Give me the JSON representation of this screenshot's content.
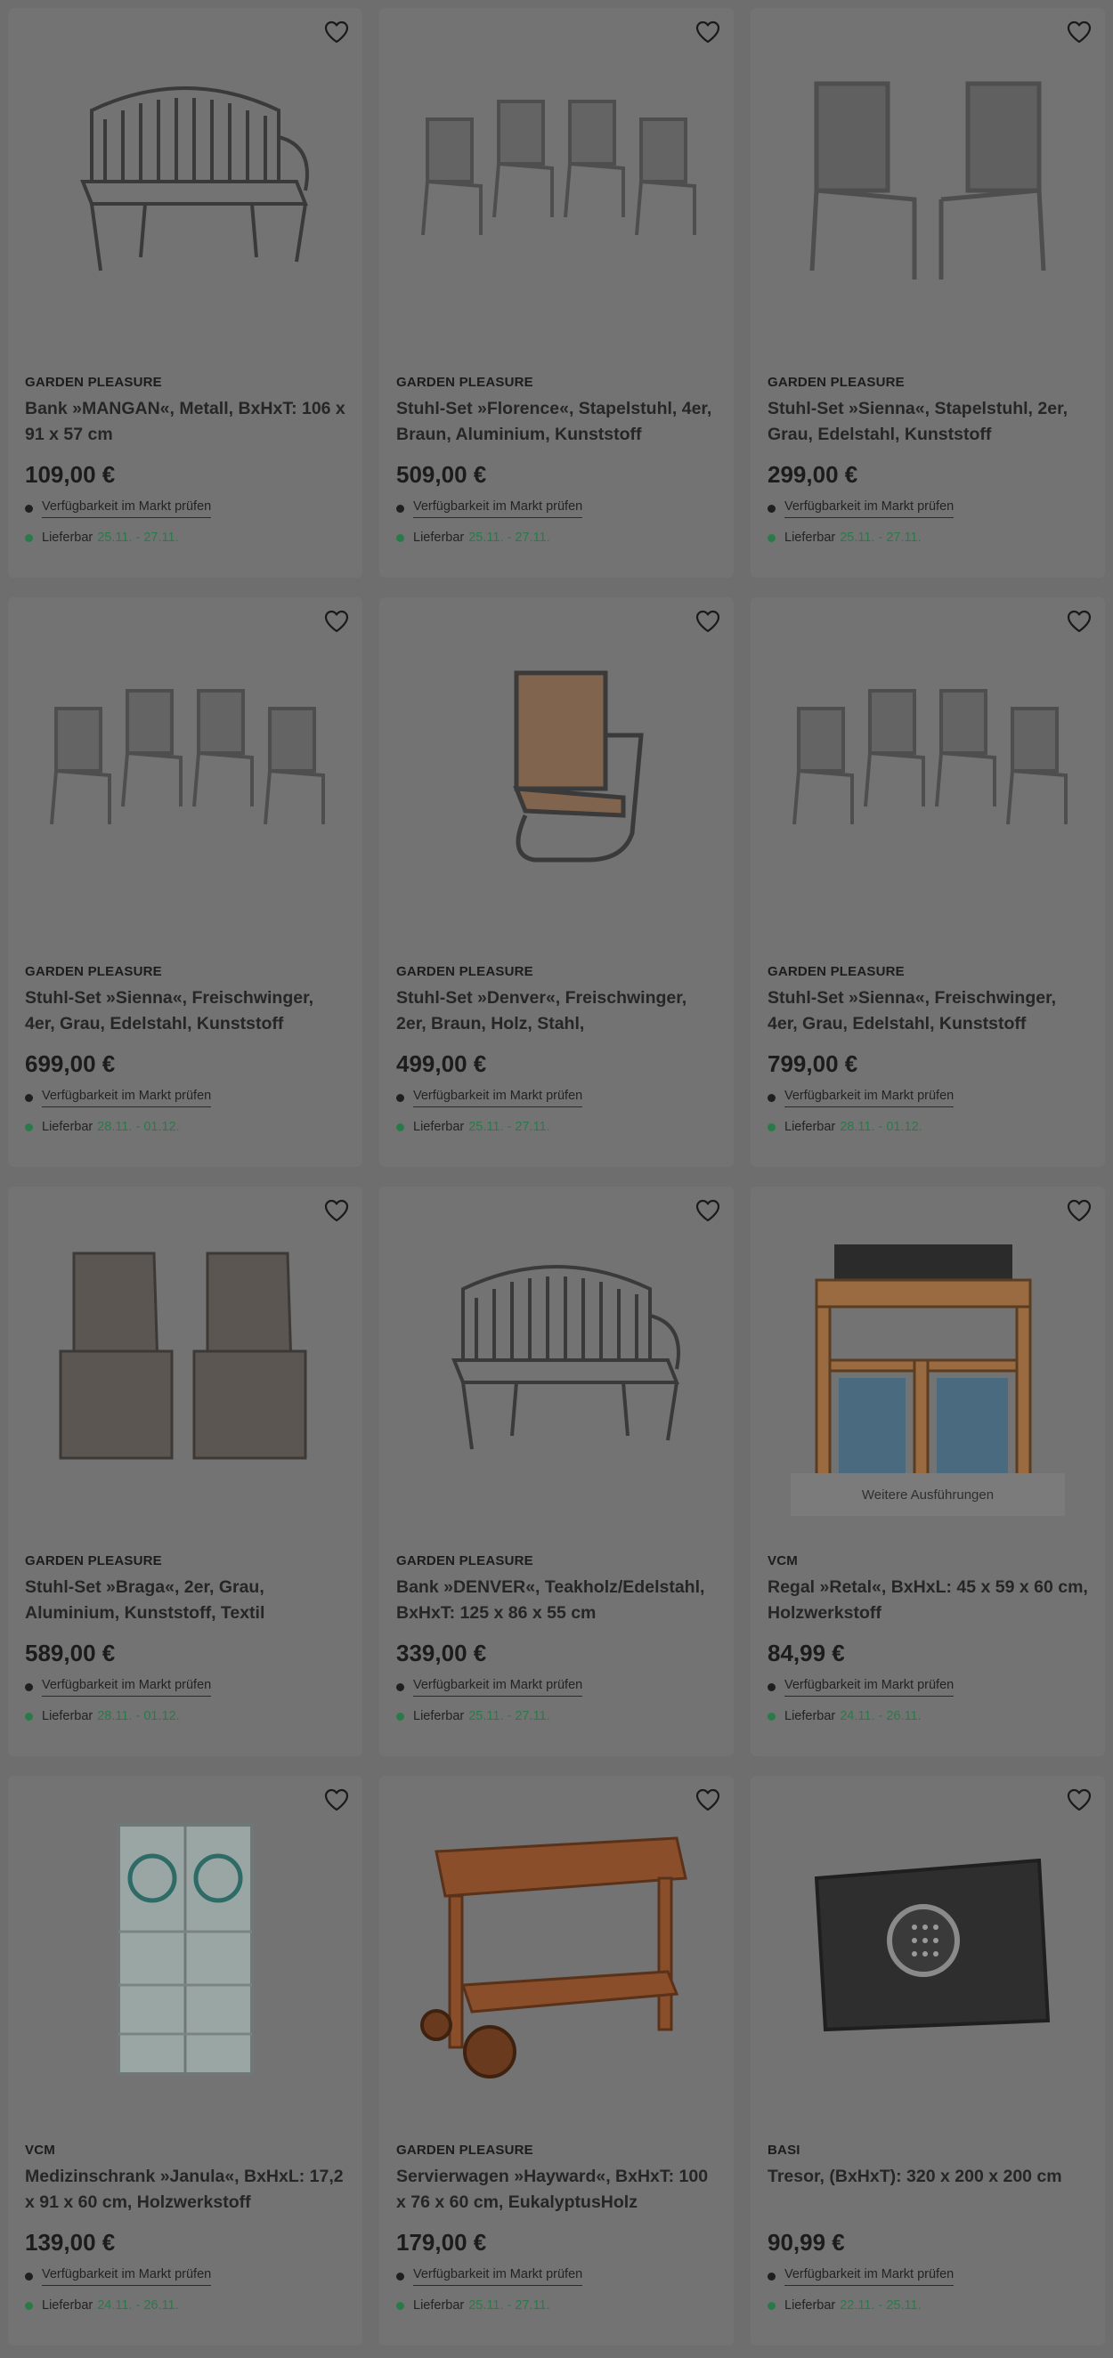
{
  "labels": {
    "availability": "Verfügbarkeit im Markt prüfen",
    "delivery": "Lieferbar",
    "variants": "Weitere Ausführungen"
  },
  "colors": {
    "overlay_background": "#6e6e6e",
    "delivery_green": "#2a7a49"
  },
  "products": [
    {
      "brand": "GARDEN PLEASURE",
      "title": "Bank »MANGAN«, Metall, BxHxT: 106 x 91 x 57 cm",
      "price": "109,00 €",
      "delivery_date": "25.11. - 27.11.",
      "icon": "bench-icon"
    },
    {
      "brand": "GARDEN PLEASURE",
      "title": "Stuhl-Set »Florence«, Stapelstuhl, 4er, Braun, Aluminium, Kunststoff",
      "price": "509,00 €",
      "delivery_date": "25.11. - 27.11.",
      "icon": "chair-set-icon"
    },
    {
      "brand": "GARDEN PLEASURE",
      "title": "Stuhl-Set »Sienna«, Stapelstuhl, 2er, Grau, Edelstahl, Kunststoff",
      "price": "299,00 €",
      "delivery_date": "25.11. - 27.11.",
      "icon": "chair-pair-icon"
    },
    {
      "brand": "GARDEN PLEASURE",
      "title": "Stuhl-Set »Sienna«, Freischwinger, 4er, Grau, Edelstahl, Kunststoff",
      "price": "699,00 €",
      "delivery_date": "28.11. - 01.12.",
      "icon": "chair-set-icon"
    },
    {
      "brand": "GARDEN PLEASURE",
      "title": "Stuhl-Set »Denver«, Freischwinger, 2er, Braun, Holz, Stahl,",
      "price": "499,00 €",
      "delivery_date": "25.11. - 27.11.",
      "icon": "chair-icon"
    },
    {
      "brand": "GARDEN PLEASURE",
      "title": "Stuhl-Set »Sienna«, Freischwinger, 4er, Grau, Edelstahl, Kunststoff",
      "price": "799,00 €",
      "delivery_date": "28.11. - 01.12.",
      "icon": "chair-set-icon"
    },
    {
      "brand": "GARDEN PLEASURE",
      "title": "Stuhl-Set »Braga«, 2er, Grau, Aluminium, Kunststoff, Textil",
      "price": "589,00 €",
      "delivery_date": "28.11. - 01.12.",
      "icon": "armchair-pair-icon"
    },
    {
      "brand": "GARDEN PLEASURE",
      "title": "Bank »DENVER«, Teakholz/Edelstahl, BxHxT: 125 x 86 x 55 cm",
      "price": "339,00 €",
      "delivery_date": "25.11. - 27.11.",
      "icon": "bench-icon"
    },
    {
      "brand": "VCM",
      "title": "Regal »Retal«, BxHxL: 45 x 59 x 60 cm, Holzwerkstoff",
      "price": "84,99 €",
      "delivery_date": "24.11. - 26.11.",
      "icon": "shelf-icon",
      "has_variants": true
    },
    {
      "brand": "VCM",
      "title": "Medizinschrank »Janula«, BxHxL: 17,2 x 91 x 60 cm, Holzwerkstoff",
      "price": "139,00 €",
      "delivery_date": "24.11. - 26.11.",
      "icon": "cabinet-icon"
    },
    {
      "brand": "GARDEN PLEASURE",
      "title": "Servierwagen »Hayward«, BxHxT: 100 x 76 x 60 cm, EukalyptusHolz",
      "price": "179,00 €",
      "delivery_date": "25.11. - 27.11.",
      "icon": "trolley-icon"
    },
    {
      "brand": "BASI",
      "title": "Tresor, (BxHxT): 320 x 200 x 200 cm",
      "price": "90,99 €",
      "delivery_date": "22.11. - 25.11.",
      "icon": "safe-icon"
    }
  ]
}
